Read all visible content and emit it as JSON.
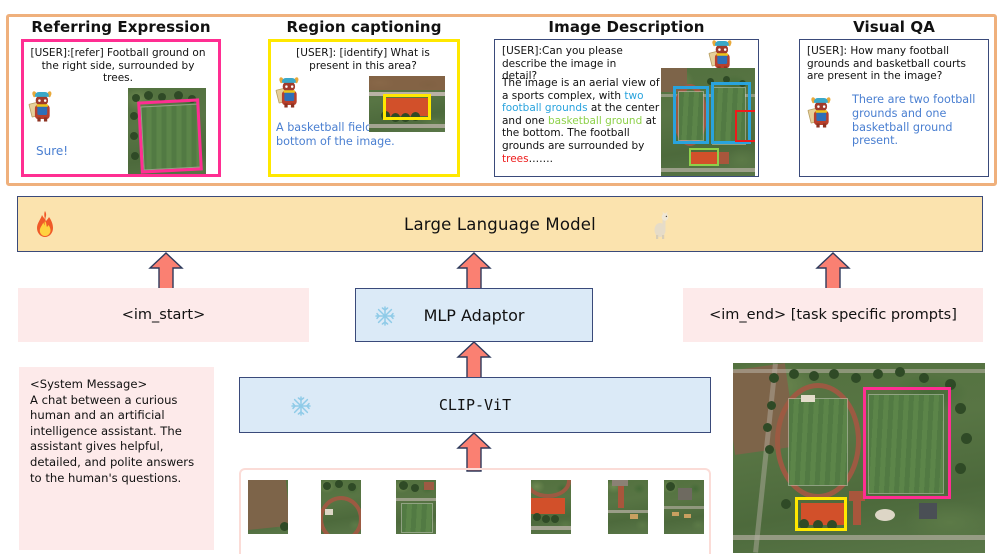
{
  "figure": {
    "accent_orange": "#efb07c",
    "pink": "#ff2e92",
    "yellow": "#ffe800",
    "blue_box_border": "#3a4a7a",
    "arrow_fill": "#fa8striped",
    "llm_bg": "#fbe3ae"
  },
  "tasks": [
    {
      "title": "Referring Expression",
      "border_color": "#ff2e92",
      "user_prompt": "[USER]:[refer] Football ground on the right side, surrounded by trees.",
      "answer": "Sure!",
      "avatar": "llama-avatar-icon",
      "thumbnail": "aerial-football-ground-thumbnail",
      "box_color": "#ff2e92"
    },
    {
      "title": "Region  captioning",
      "border_color": "#ffe800",
      "user_prompt": "[USER]: [identify] What is present in this area?",
      "answer": "A basketball field at the bottom of the image.",
      "avatar": "llama-avatar-icon",
      "thumbnail": "aerial-basketball-court-thumbnail",
      "box_color": "#ffe800"
    },
    {
      "title": "Image Description",
      "border_color": "#3a4a7a",
      "user_prompt": "[USER]:Can you please describe the image in detail?",
      "answer_segments": [
        {
          "text": "The image is an aerial view of a sports complex, with ",
          "color": "#111111"
        },
        {
          "text": "two football grounds",
          "color": "#29a3dd"
        },
        {
          "text": " at the center and one ",
          "color": "#111111"
        },
        {
          "text": "basketball ground",
          "color": "#8ed14a"
        },
        {
          "text": " at the bottom. The football grounds are surrounded by ",
          "color": "#111111"
        },
        {
          "text": "trees",
          "color": "#ee1b1b"
        },
        {
          "text": "…….",
          "color": "#111111"
        }
      ],
      "avatar": "llama-avatar-icon",
      "thumbnail": "aerial-sports-complex-thumbnail"
    },
    {
      "title": "Visual QA",
      "border_color": "#3a4a7a",
      "user_prompt": "[USER]: How many football grounds and basketball courts are present in the image?",
      "answer": "There are two football grounds and one basketball ground present.",
      "avatar": "llama-avatar-icon"
    }
  ],
  "llm": {
    "label": "Large Language Model",
    "fire_icon": "fire-icon",
    "llama_icon": "llama-icon",
    "bg": "#fbe3ae"
  },
  "blocks": {
    "im_start": "<im_start>",
    "im_end": "<im_end> [task specific prompts]",
    "mlp_adaptor": "MLP Adaptor",
    "clip_vit": "CLIP-ViT",
    "snowflake_icon": "snowflake-icon"
  },
  "system_message": {
    "header": "<System Message>",
    "body": "A chat between a curious human and an artificial intelligence assistant. The assistant gives helpful, detailed, and polite answers to the human's questions."
  },
  "patches": {
    "label": "image-patch-strip",
    "count": 6
  },
  "input_image": {
    "label": "aerial-sports-complex-input-image",
    "annotations": [
      {
        "name": "football-ground-box",
        "color": "#ff2e92"
      },
      {
        "name": "basketball-court-box",
        "color": "#ffe800"
      }
    ]
  },
  "arrows": [
    {
      "name": "arrow-im-start-to-llm"
    },
    {
      "name": "arrow-mlp-to-llm"
    },
    {
      "name": "arrow-im-end-to-llm"
    },
    {
      "name": "arrow-clip-to-mlp"
    },
    {
      "name": "arrow-patches-to-clip"
    }
  ]
}
